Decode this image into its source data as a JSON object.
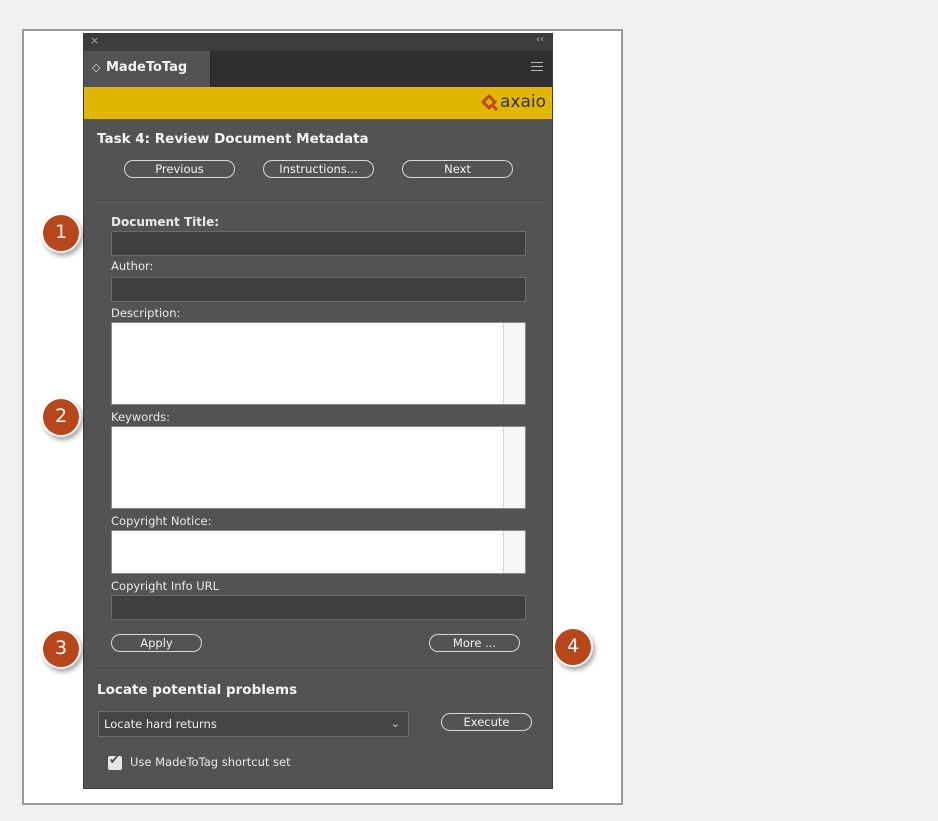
{
  "panel": {
    "close_glyph": "×",
    "collapse_glyph": "‹‹",
    "tab_arrows": "◇",
    "tab_title": "MadeToTag",
    "logo_text": "axaio",
    "task_title": "Task 4: Review Document Metadata",
    "buttons": {
      "previous": "Previous",
      "instructions": "Instructions...",
      "next": "Next",
      "apply": "Apply",
      "more": "More ...",
      "execute": "Execute"
    },
    "fields": {
      "document_title": {
        "label": "Document Title:",
        "value": ""
      },
      "author": {
        "label": "Author:",
        "value": ""
      },
      "description": {
        "label": "Description:",
        "value": ""
      },
      "keywords": {
        "label": "Keywords:",
        "value": ""
      },
      "copyright_notice": {
        "label": "Copyright Notice:",
        "value": ""
      },
      "copyright_info_url": {
        "label": "Copyright Info URL",
        "value": ""
      }
    },
    "locate_section": {
      "title": "Locate potential problems",
      "dropdown_selected": "Locate hard returns",
      "chevron_glyph": "⌄"
    },
    "shortcut": {
      "checked": true,
      "check_glyph": "✔",
      "label": "Use MadeToTag shortcut set"
    }
  },
  "markers": [
    "1",
    "2",
    "3",
    "4"
  ],
  "colors": {
    "brand_bar": "#e0b600",
    "panel_bg": "#535353",
    "marker": "#b8461b",
    "logo_accent": "#c0461b"
  }
}
